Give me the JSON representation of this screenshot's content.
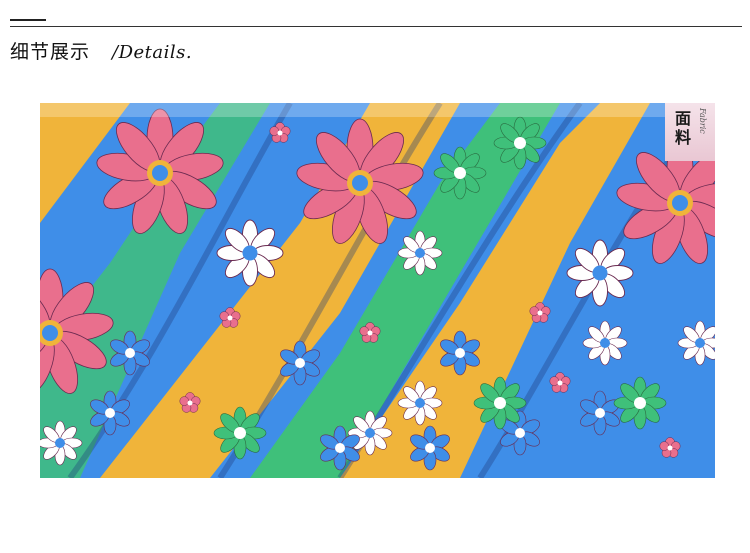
{
  "header": {
    "title_cn": "细节展示",
    "title_en": "/Details."
  },
  "photo": {
    "subject": "floral-print-fabric",
    "palette": {
      "blue": "#3f8ee8",
      "pink": "#e96f8d",
      "yellow": "#f0b43a",
      "green": "#3fc07a",
      "white": "#ffffff",
      "outline": "#6a2a50"
    }
  },
  "badge": {
    "label": "面料",
    "script": "Fabric"
  }
}
